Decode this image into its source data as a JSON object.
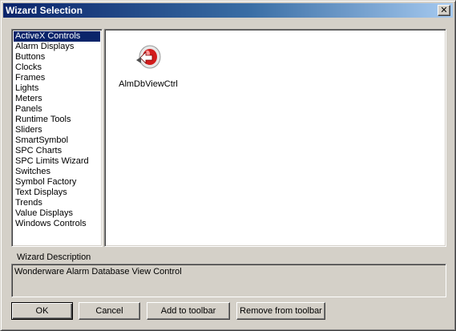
{
  "window": {
    "title": "Wizard Selection",
    "close_glyph": "✕"
  },
  "categories": [
    {
      "label": "ActiveX Controls",
      "selected": true
    },
    {
      "label": "Alarm Displays"
    },
    {
      "label": "Buttons"
    },
    {
      "label": "Clocks"
    },
    {
      "label": "Frames"
    },
    {
      "label": "Lights"
    },
    {
      "label": "Meters"
    },
    {
      "label": "Panels"
    },
    {
      "label": "Runtime Tools"
    },
    {
      "label": "Sliders"
    },
    {
      "label": "SmartSymbol"
    },
    {
      "label": "SPC Charts"
    },
    {
      "label": "SPC Limits Wizard"
    },
    {
      "label": "Switches"
    },
    {
      "label": "Symbol Factory"
    },
    {
      "label": "Text Displays"
    },
    {
      "label": "Trends"
    },
    {
      "label": "Value Displays"
    },
    {
      "label": "Windows Controls"
    }
  ],
  "wizard_items": [
    {
      "label": "AlmDbViewCtrl",
      "icon": "alarm-db-view-icon"
    }
  ],
  "description": {
    "label": "Wizard Description",
    "text": "Wonderware Alarm Database View Control"
  },
  "buttons": {
    "ok": "OK",
    "cancel": "Cancel",
    "add_toolbar": "Add to toolbar",
    "remove_toolbar": "Remove from  toolbar"
  },
  "colors": {
    "title_start": "#0a246a",
    "title_end": "#a6caf0",
    "selection": "#0a246a",
    "face": "#d4d0c8"
  }
}
